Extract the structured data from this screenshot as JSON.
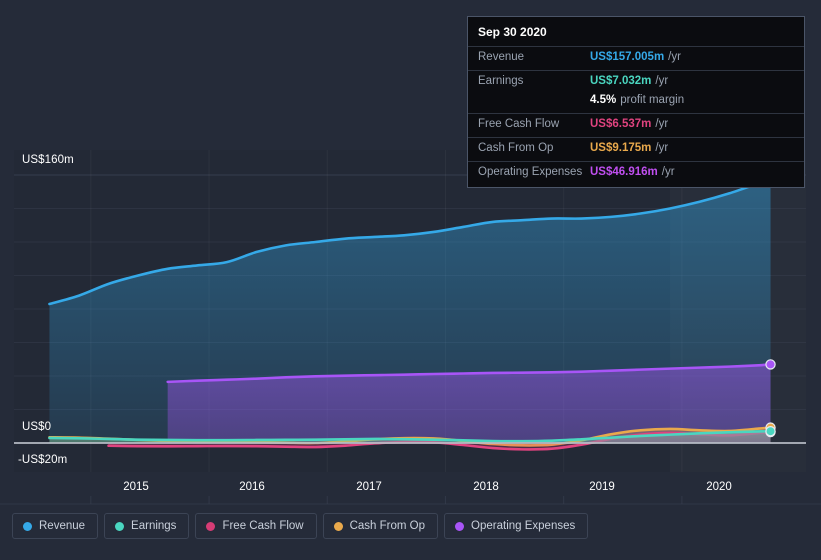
{
  "colors": {
    "background": "#252b39",
    "plot_background": "#232936",
    "revenue": "#35a9e8",
    "earnings": "#4ad6c0",
    "free_cash_flow": "#e0437f",
    "cash_from_op": "#e9a94c",
    "operating_expenses": "#a855f7",
    "gridline": "#3a4152",
    "zero_line": "#b9bec7",
    "tooltip_background": "#0b0c10",
    "tooltip_border": "#4b5568",
    "muted_text": "#9aa3b1"
  },
  "tooltip": {
    "date": "Sep 30 2020",
    "rows": [
      {
        "key": "Revenue",
        "value": "US$157.005m",
        "unit": "/yr",
        "color": "#35a9e8"
      },
      {
        "key": "Earnings",
        "value": "US$7.032m",
        "unit": "/yr",
        "color": "#4ad6c0"
      },
      {
        "key": "",
        "value": "4.5%",
        "unit": "profit margin",
        "color": "#ffffff",
        "sub": true
      },
      {
        "key": "Free Cash Flow",
        "value": "US$6.537m",
        "unit": "/yr",
        "color": "#e0437f"
      },
      {
        "key": "Cash From Op",
        "value": "US$9.175m",
        "unit": "/yr",
        "color": "#e9a94c"
      },
      {
        "key": "Operating Expenses",
        "value": "US$46.916m",
        "unit": "/yr",
        "color": "#c04ff0"
      }
    ]
  },
  "legend": {
    "items": [
      {
        "label": "Revenue",
        "color": "#35a9e8"
      },
      {
        "label": "Earnings",
        "color": "#4ad6c0"
      },
      {
        "label": "Free Cash Flow",
        "color": "#d63c75"
      },
      {
        "label": "Cash From Op",
        "color": "#e9a94c"
      },
      {
        "label": "Operating Expenses",
        "color": "#a855f7"
      }
    ]
  },
  "axes": {
    "y_labels": [
      {
        "text": "US$160m",
        "value": 160
      },
      {
        "text": "US$0",
        "value": 0
      },
      {
        "text": "-US$20m",
        "value": -20
      }
    ],
    "x_labels": [
      "2015",
      "2016",
      "2017",
      "2018",
      "2019",
      "2020"
    ]
  },
  "chart_data": {
    "type": "area",
    "title": "",
    "xlabel": "",
    "ylabel": "",
    "currency": "US$ millions per year",
    "ylim": [
      -20,
      160
    ],
    "xlim": [
      2014.35,
      2021.05
    ],
    "grid": true,
    "legend_position": "bottom",
    "y_ticks": [
      160,
      0,
      -20
    ],
    "x_ticks": [
      2015,
      2016,
      2017,
      2018,
      2019,
      2020
    ],
    "annotation": {
      "date": "Sep 30 2020",
      "revenue": 157.005,
      "earnings": 7.032,
      "profit_margin_pct": 4.5,
      "free_cash_flow": 6.537,
      "cash_from_op": 9.175,
      "operating_expenses": 46.916
    },
    "x": [
      2014.65,
      2014.9,
      2015.15,
      2015.4,
      2015.65,
      2015.9,
      2016.15,
      2016.4,
      2016.65,
      2016.9,
      2017.15,
      2017.4,
      2017.65,
      2017.9,
      2018.15,
      2018.4,
      2018.65,
      2018.9,
      2019.15,
      2019.4,
      2019.65,
      2019.9,
      2020.15,
      2020.4,
      2020.65,
      2020.75
    ],
    "series": [
      {
        "name": "Revenue",
        "color": "#35a9e8",
        "values": [
          83,
          88,
          95,
          100,
          104,
          106,
          108,
          114,
          118,
          120,
          122,
          123,
          124,
          126,
          129,
          132,
          133,
          134,
          134,
          135,
          137,
          140,
          144,
          149,
          155,
          157.005
        ]
      },
      {
        "name": "Earnings",
        "color": "#4ad6c0",
        "values": [
          3.0,
          2.8,
          2.4,
          2.0,
          1.8,
          1.7,
          1.7,
          1.8,
          1.9,
          2.0,
          2.2,
          2.4,
          2.3,
          2.0,
          1.6,
          1.2,
          1.1,
          1.4,
          2.2,
          3.2,
          4.2,
          5.0,
          5.8,
          6.4,
          6.9,
          7.032
        ]
      },
      {
        "name": "Free Cash Flow",
        "color": "#e0437f",
        "values": [
          null,
          null,
          -1.6,
          -1.9,
          -2.0,
          -1.9,
          -1.8,
          -1.9,
          -2.2,
          -2.4,
          -1.6,
          -0.2,
          0.6,
          0.4,
          -1.2,
          -3.0,
          -3.8,
          -3.4,
          -1.0,
          2.5,
          5.0,
          6.0,
          5.2,
          4.6,
          6.0,
          6.537
        ]
      },
      {
        "name": "Cash From Op",
        "color": "#e9a94c",
        "values": [
          3.4,
          3.2,
          2.6,
          1.8,
          1.2,
          0.9,
          0.9,
          0.6,
          0.2,
          0.0,
          0.9,
          2.2,
          2.9,
          2.7,
          1.2,
          -0.6,
          -1.4,
          -1.0,
          1.6,
          5.2,
          7.6,
          8.4,
          7.6,
          7.2,
          8.6,
          9.175
        ]
      },
      {
        "name": "Operating Expenses",
        "color": "#a855f7",
        "values": [
          null,
          null,
          null,
          null,
          36.5,
          37.2,
          37.8,
          38.4,
          39.2,
          39.8,
          40.2,
          40.5,
          40.8,
          41.2,
          41.5,
          41.8,
          42.0,
          42.2,
          42.6,
          43.2,
          43.8,
          44.4,
          45.0,
          45.6,
          46.4,
          46.916
        ]
      }
    ]
  }
}
